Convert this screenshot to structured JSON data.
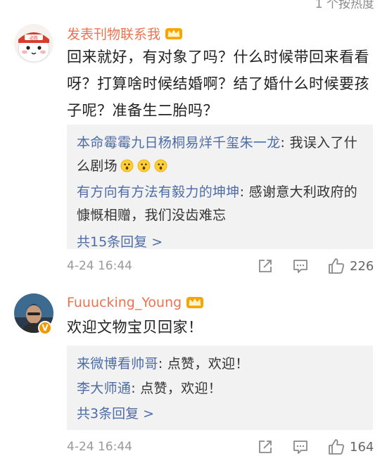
{
  "top_partial_text": "1 个按热度",
  "comments": [
    {
      "username": "发表刊物联系我",
      "text": "回来就好，有对象了吗？什么时候带回来看看呀？打算啥时候结婚啊？结了婚什么时候要孩子呢？准备生二胎吗？",
      "replies": [
        {
          "name": "本命霉霉九日杨桐易烊千玺朱一龙",
          "sep": ": ",
          "text": "我误入了什么剧场"
        },
        {
          "name": "有方向有方法有毅力的坤坤",
          "sep": ": ",
          "text": "感谢意大利政府的慷慨相赠，我们没齿难忘"
        }
      ],
      "more_replies": "共15条回复 >",
      "timestamp": "4-24 16:44",
      "likes": "226"
    },
    {
      "username": "Fuuucking_Young",
      "text": "欢迎文物宝贝回家！",
      "replies": [
        {
          "name": "来微博看帅哥",
          "sep": ": ",
          "text": "点赞，欢迎！"
        },
        {
          "name": "李大师通",
          "sep": ": ",
          "text": "点赞，欢迎！"
        }
      ],
      "more_replies": "共3条回复 >",
      "timestamp": "4-24 16:44",
      "likes": "164"
    }
  ],
  "icons": {
    "crown": "crown-badge-icon",
    "verified": "verified-v-icon",
    "share": "share-icon",
    "comment": "comment-icon",
    "like": "like-thumb-icon",
    "emoji": "surprised-face-emoji-icon"
  },
  "colors": {
    "username": "#eb7350",
    "reply_name": "#4e6ca6",
    "reply_bg": "#f2f2f2",
    "timestamp": "#999999",
    "verified": "#f29900"
  }
}
